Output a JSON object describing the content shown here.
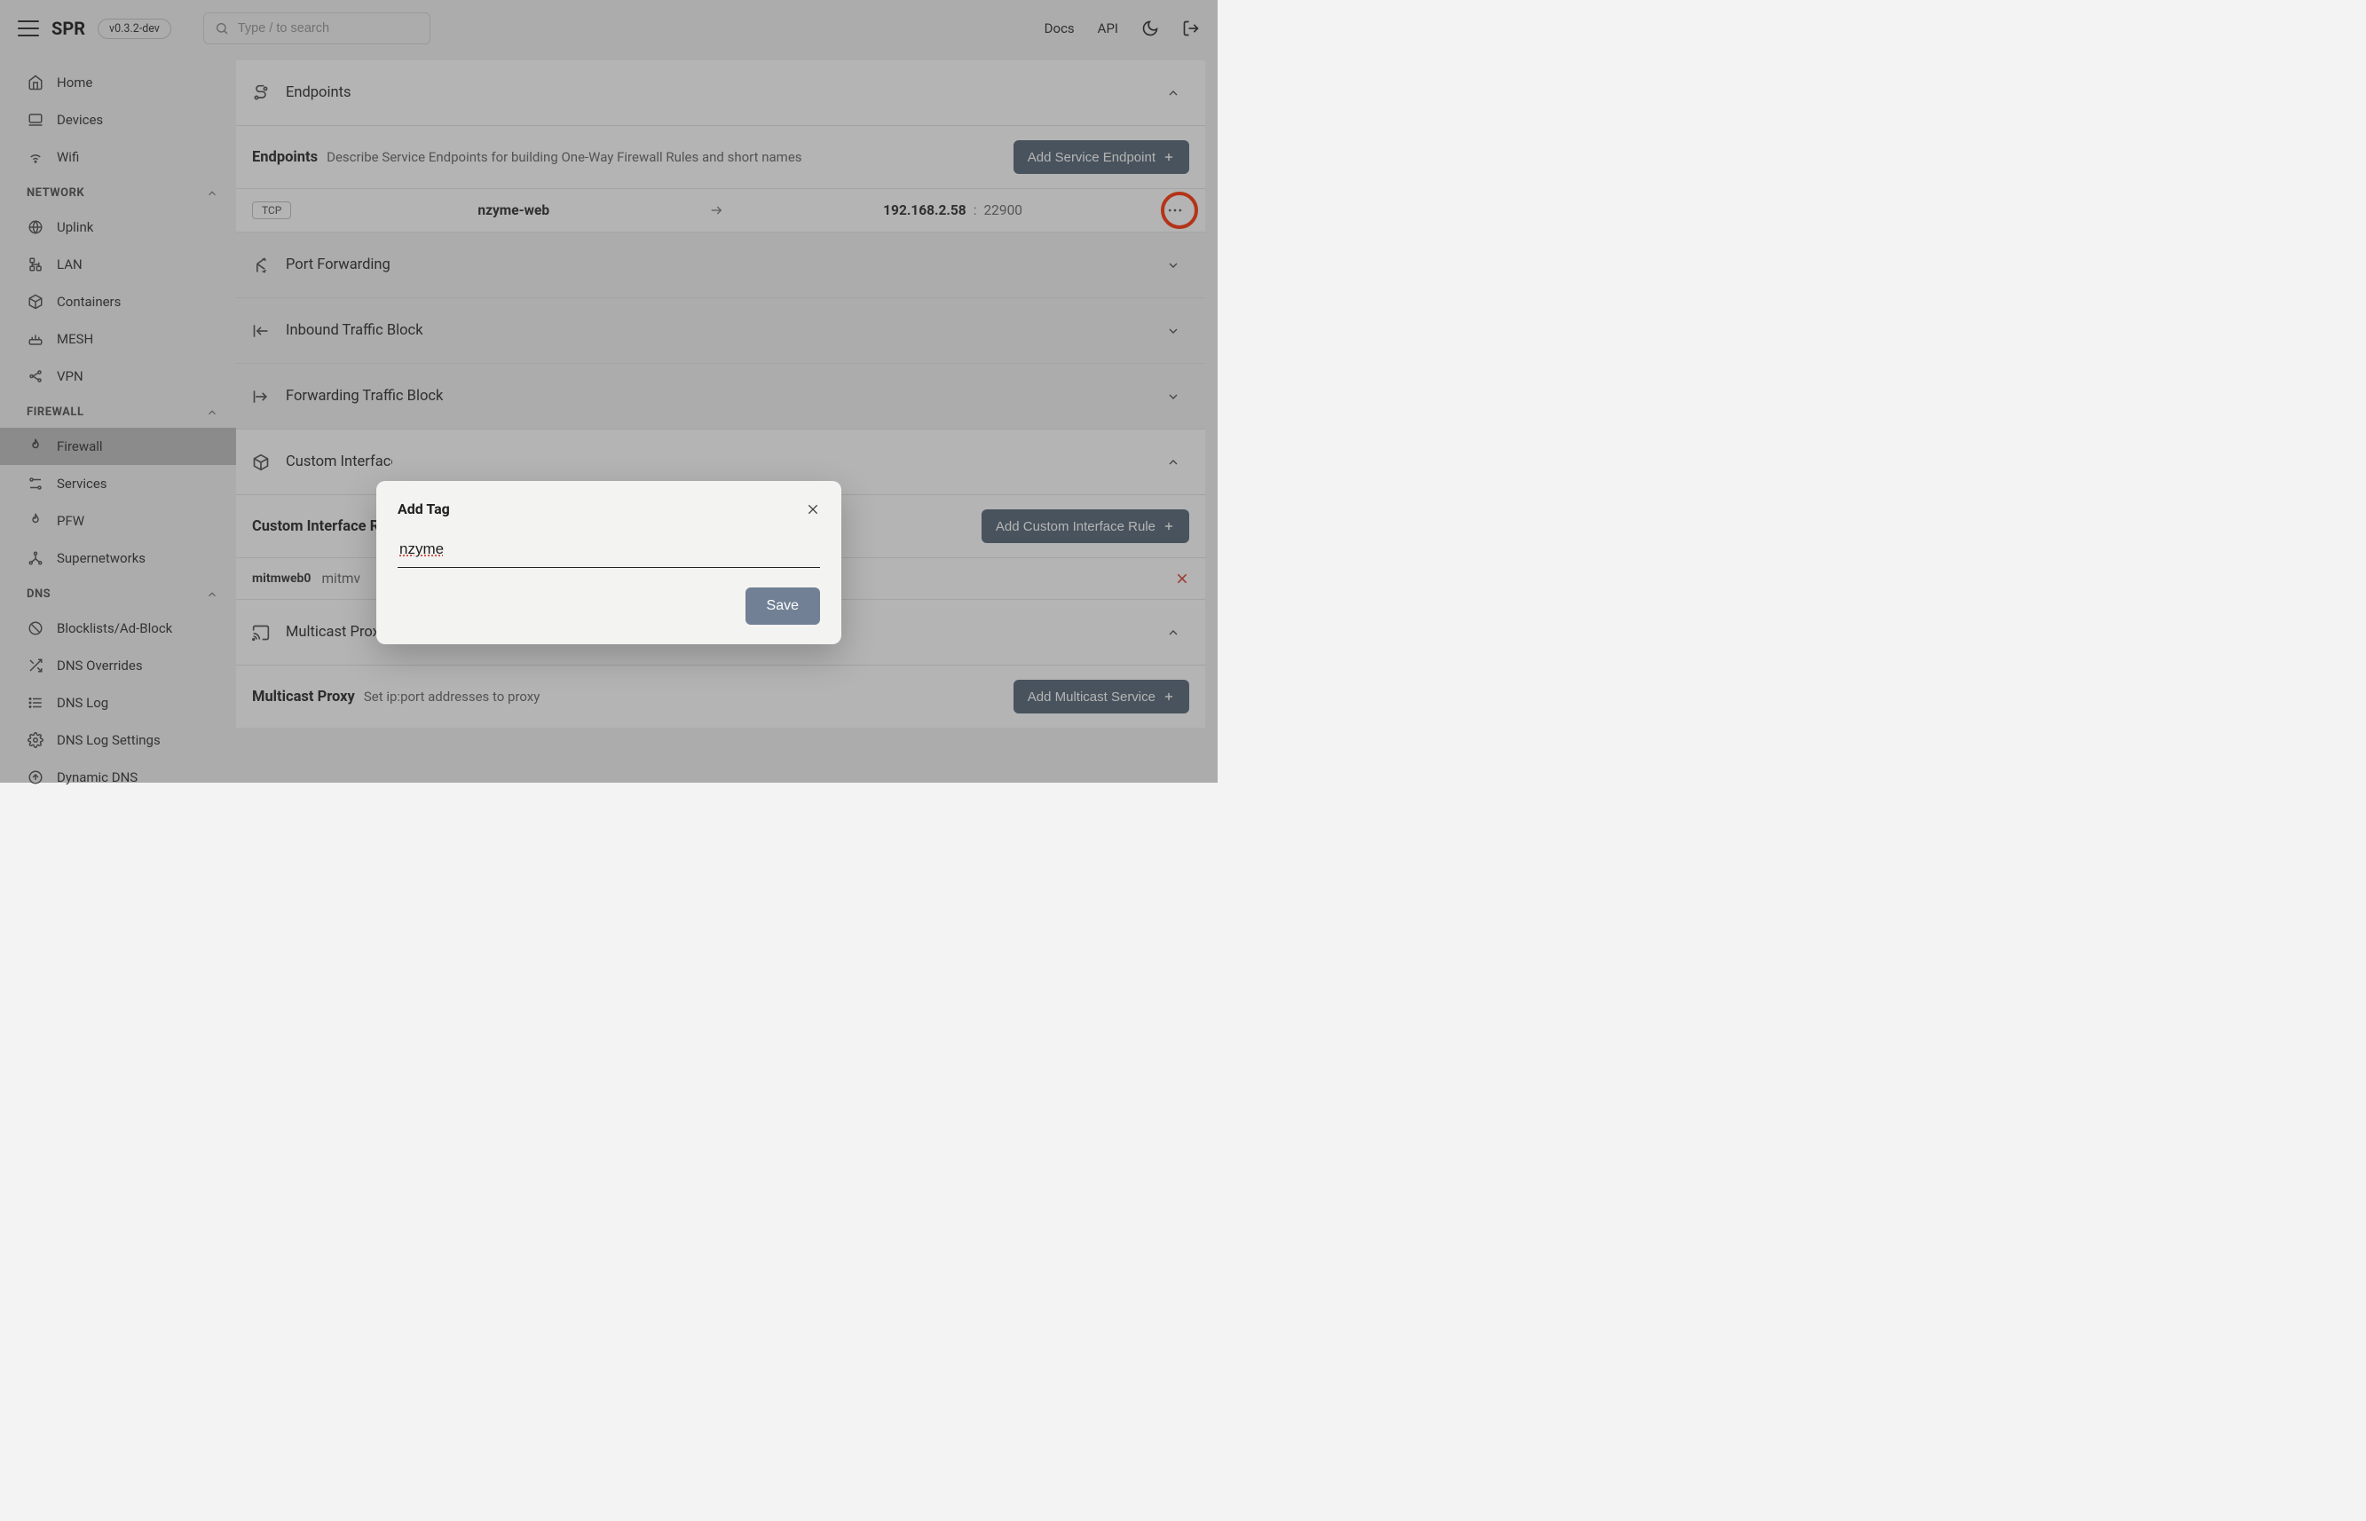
{
  "app": {
    "brand": "SPR",
    "version": "v0.3.2-dev"
  },
  "search": {
    "placeholder": "Type / to search"
  },
  "topnav": {
    "docs": "Docs",
    "api": "API"
  },
  "sidebar": {
    "top": [
      {
        "label": "Home"
      },
      {
        "label": "Devices"
      },
      {
        "label": "Wifi"
      }
    ],
    "sections": [
      {
        "title": "NETWORK",
        "items": [
          {
            "label": "Uplink"
          },
          {
            "label": "LAN"
          },
          {
            "label": "Containers"
          },
          {
            "label": "MESH"
          },
          {
            "label": "VPN"
          }
        ]
      },
      {
        "title": "FIREWALL",
        "items": [
          {
            "label": "Firewall",
            "active": true
          },
          {
            "label": "Services"
          },
          {
            "label": "PFW"
          },
          {
            "label": "Supernetworks"
          }
        ]
      },
      {
        "title": "DNS",
        "items": [
          {
            "label": "Blocklists/Ad-Block"
          },
          {
            "label": "DNS Overrides"
          },
          {
            "label": "DNS Log"
          },
          {
            "label": "DNS Log Settings"
          },
          {
            "label": "Dynamic DNS"
          }
        ]
      }
    ]
  },
  "panels": {
    "endpoints": {
      "title": "Endpoints",
      "sub_title": "Endpoints",
      "sub_desc": "Describe Service Endpoints for building One-Way Firewall Rules and short names",
      "add_btn": "Add Service Endpoint",
      "row": {
        "proto": "TCP",
        "name": "nzyme-web",
        "ip": "192.168.2.58",
        "port": "22900"
      }
    },
    "port_fwd": {
      "title": "Port Forwarding"
    },
    "inbound_block": {
      "title": "Inbound Traffic Block"
    },
    "fwd_block": {
      "title": "Forwarding Traffic Block"
    },
    "custom_iface": {
      "title": "Custom Interface Access",
      "sub_title": "Custom Interface Rule",
      "add_btn": "Add Custom Interface Rule",
      "row": {
        "iface": "mitmweb0",
        "val_prefix": "mitmv"
      }
    },
    "mcast": {
      "title": "Multicast Proxy",
      "sub_title": "Multicast Proxy",
      "sub_desc": "Set ip:port addresses to proxy",
      "add_btn": "Add Multicast Service"
    }
  },
  "modal": {
    "title": "Add Tag",
    "value": "nzyme",
    "save": "Save"
  }
}
